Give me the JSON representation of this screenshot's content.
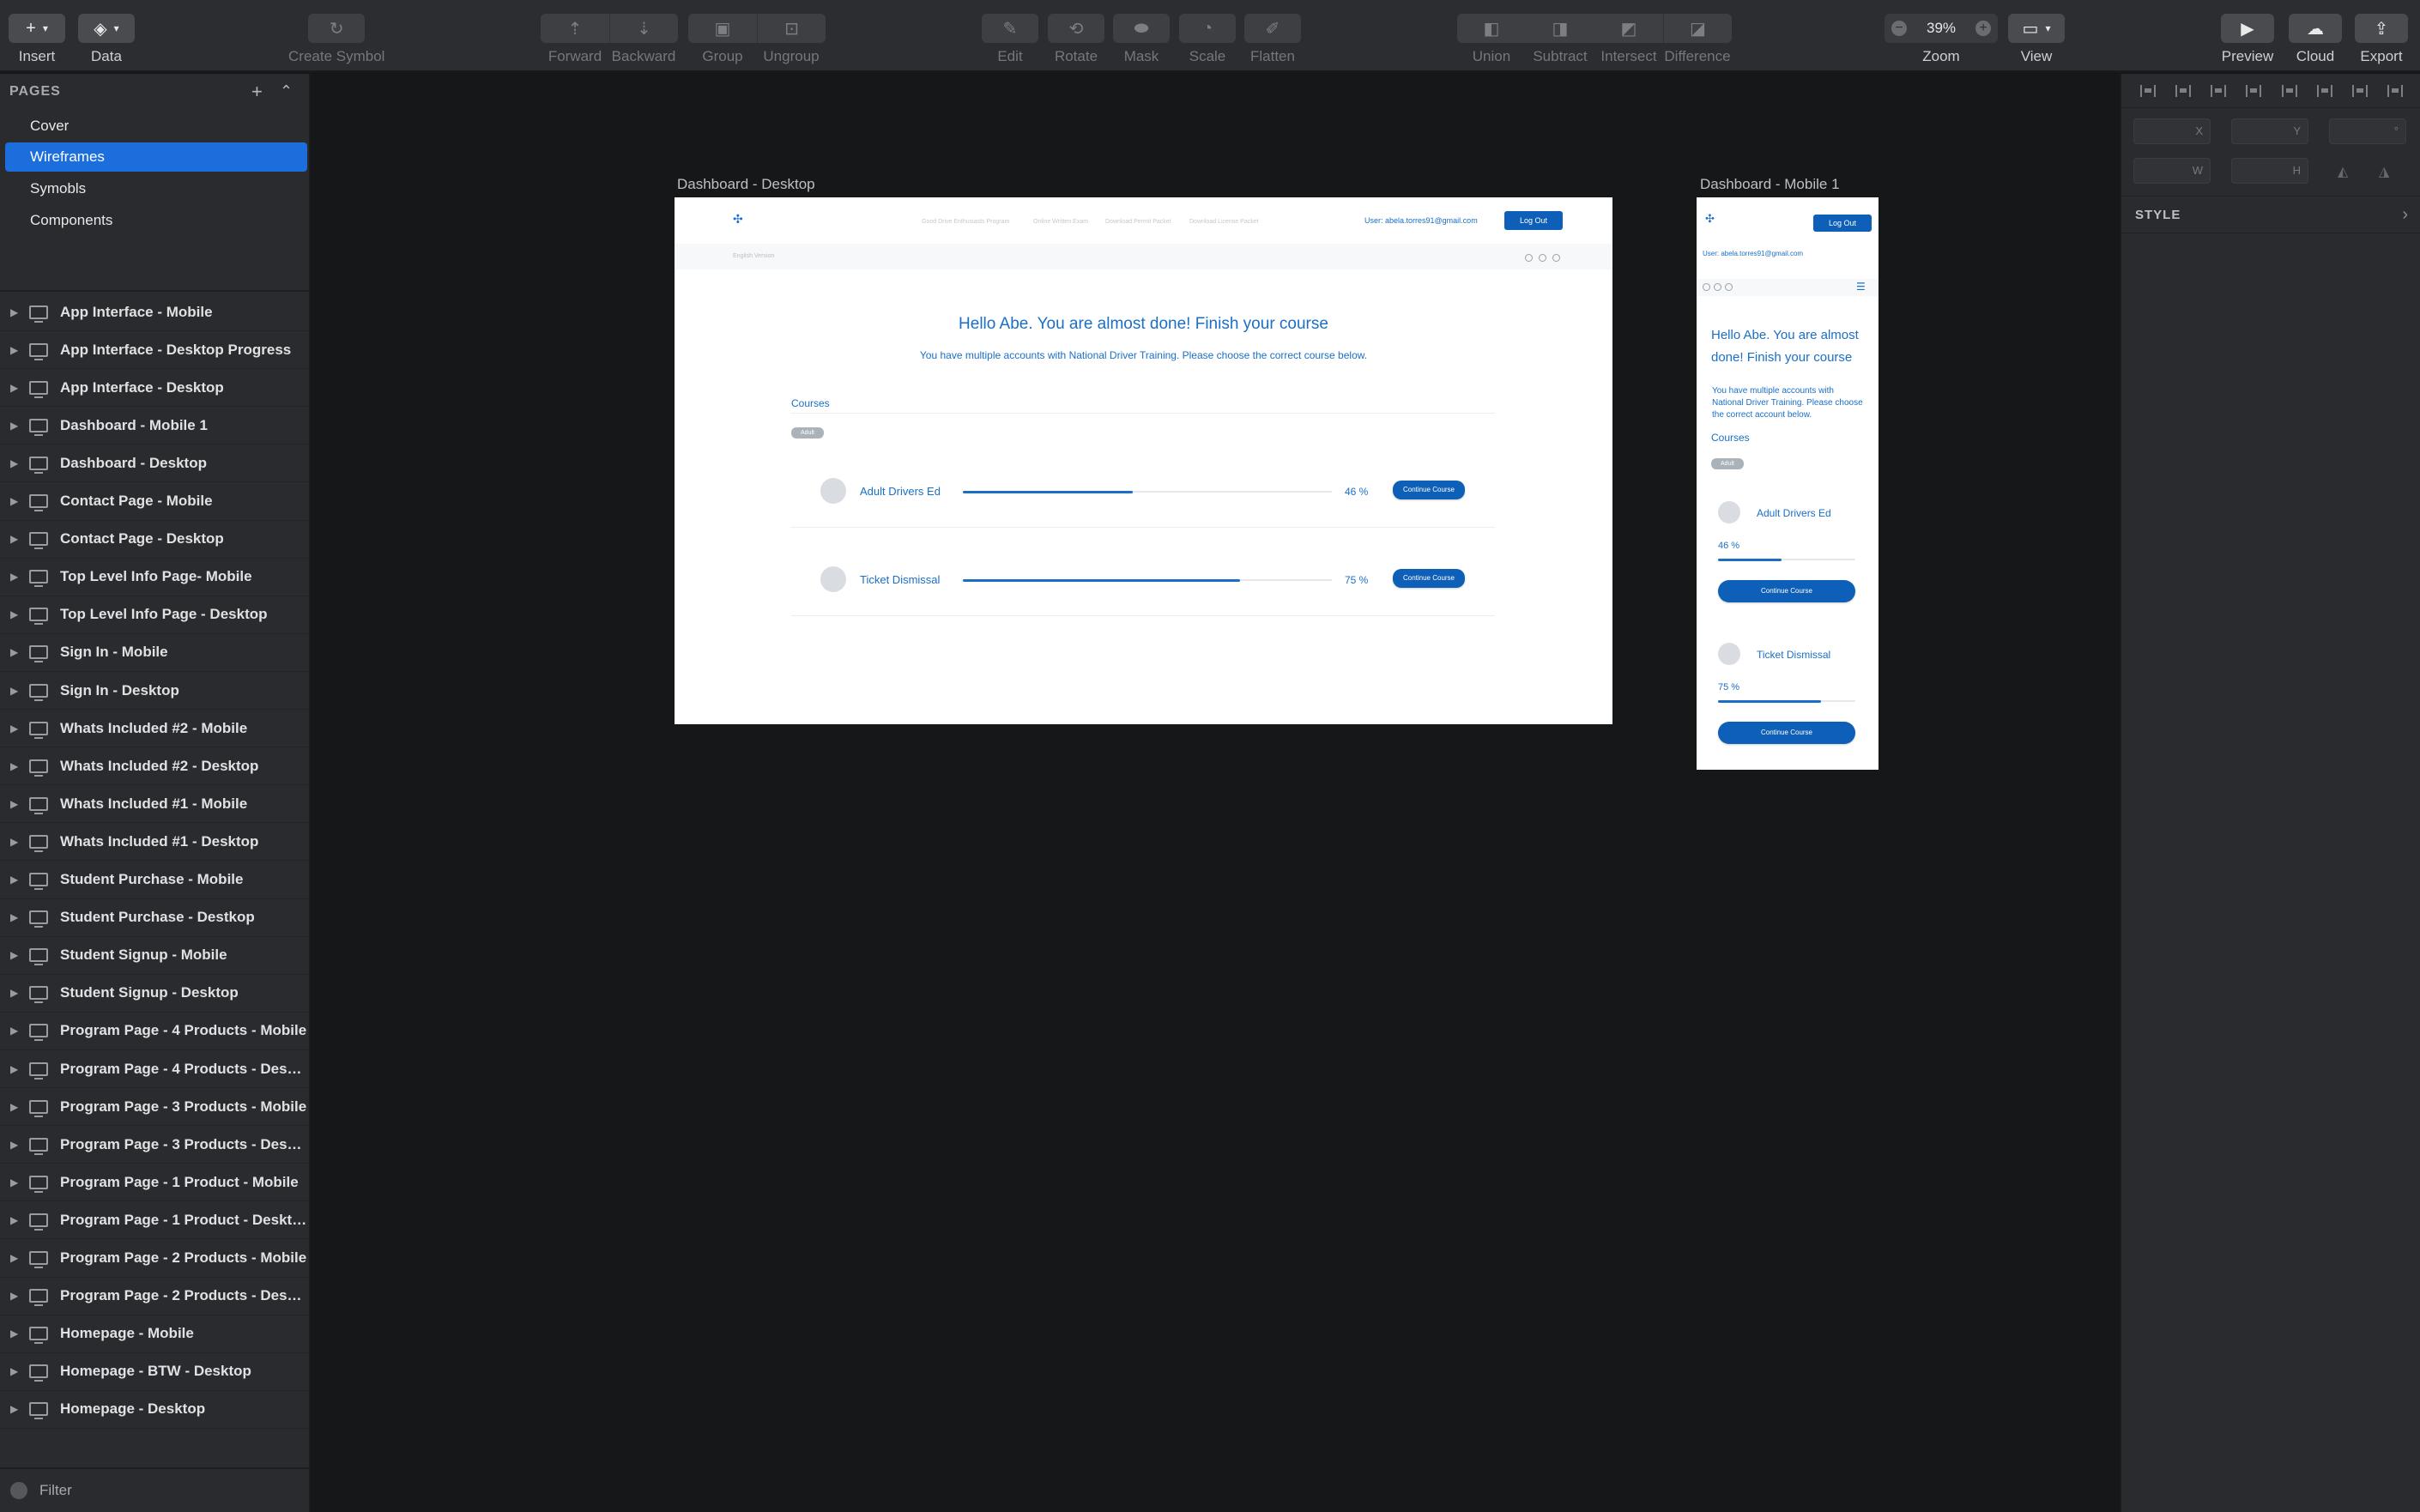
{
  "toolbar": {
    "insert": "Insert",
    "data": "Data",
    "create_symbol": "Create Symbol",
    "forward": "Forward",
    "backward": "Backward",
    "group": "Group",
    "ungroup": "Ungroup",
    "edit": "Edit",
    "rotate": "Rotate",
    "mask": "Mask",
    "scale": "Scale",
    "flatten": "Flatten",
    "union": "Union",
    "subtract": "Subtract",
    "intersect": "Intersect",
    "difference": "Difference",
    "zoom_label": "Zoom",
    "zoom_value": "39%",
    "view": "View",
    "preview": "Preview",
    "cloud": "Cloud",
    "export": "Export"
  },
  "sidebar": {
    "pages_title": "PAGES",
    "pages": [
      {
        "label": "Cover"
      },
      {
        "label": "Wireframes",
        "selected": true
      },
      {
        "label": "Symobls"
      },
      {
        "label": "Components"
      }
    ],
    "layers": [
      "App Interface - Mobile",
      "App Interface - Desktop Progress",
      "App Interface - Desktop",
      "Dashboard - Mobile 1",
      "Dashboard - Desktop",
      "Contact Page - Mobile",
      "Contact Page - Desktop",
      "Top Level Info Page- Mobile",
      "Top Level Info Page - Desktop",
      "Sign In - Mobile",
      "Sign In - Desktop",
      "Whats Included #2 - Mobile",
      "Whats Included #2 - Desktop",
      "Whats Included #1 - Mobile",
      "Whats Included #1 - Desktop",
      "Student Purchase - Mobile",
      "Student Purchase - Destkop",
      "Student Signup - Mobile",
      "Student Signup - Desktop",
      "Program Page -  4 Products - Mobile",
      "Program Page -  4 Products - Desktop",
      "Program Page - 3 Products - Mobile",
      "Program Page -  3 Products - Desktop",
      "Program Page - 1 Product - Mobile",
      "Program Page - 1 Product - Desktop",
      "Program Page - 2 Products - Mobile",
      "Program Page - 2 Products - Desktop",
      "Homepage - Mobile",
      "Homepage - BTW - Desktop",
      "Homepage - Desktop"
    ],
    "filter": "Filter"
  },
  "inspector": {
    "x": "X",
    "y": "Y",
    "deg": "°",
    "w": "W",
    "h": "H",
    "style": "STYLE"
  },
  "desktop": {
    "label": "Dashboard - Desktop",
    "nav": [
      "Good Drive Enthusiasts Program",
      "Online Written Exam",
      "Download Permit Packet",
      "Download License Packet"
    ],
    "user": "User: abela.torres91@gmail.com",
    "logout": "Log Out",
    "lang": "English Version",
    "hello": "Hello Abe. You are almost done! Finish your course",
    "sub": "You have multiple accounts with National Driver Training. Please choose the correct course below.",
    "courses_title": "Courses",
    "tag": "Adult",
    "courses": [
      {
        "name": "Adult Drivers Ed",
        "pct_label": "46 %",
        "progress": 0.46,
        "button": "Continue Course"
      },
      {
        "name": "Ticket Dismissal",
        "pct_label": "75 %",
        "progress": 0.75,
        "button": "Continue Course"
      }
    ]
  },
  "mobile": {
    "label": "Dashboard - Mobile 1",
    "logout": "Log Out",
    "user": "User: abela.torres91@gmail.com",
    "hello": "Hello Abe. You are almost done! Finish your course",
    "sub": "You have multiple accounts with National Driver Training. Please choose the correct account below.",
    "courses_title": "Courses",
    "tag": "Adult",
    "courses": [
      {
        "name": "Adult Drivers Ed",
        "pct_label": "46 %",
        "progress": 0.46,
        "button": "Continue Course"
      },
      {
        "name": "Ticket Dismissal",
        "pct_label": "75 %",
        "progress": 0.75,
        "button": "Continue Course"
      }
    ]
  },
  "colors": {
    "accent": "#1b6edc",
    "brand_blue": "#1a6fc7",
    "button_blue": "#0d5fb8"
  }
}
